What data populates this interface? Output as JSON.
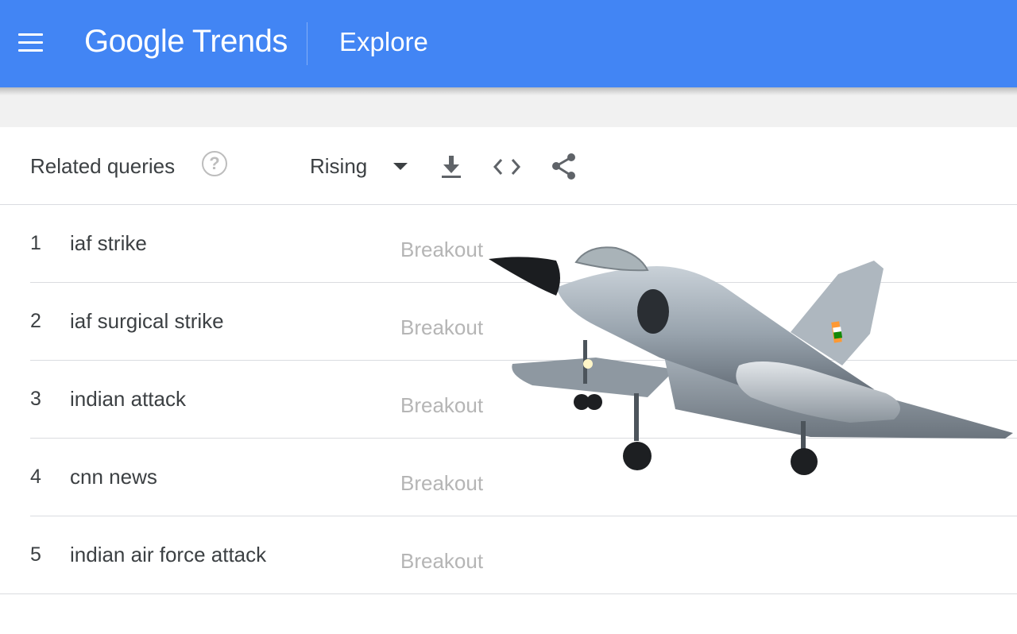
{
  "header": {
    "brand": "Google Trends",
    "title": "Explore",
    "menu_icon": "hamburger-menu-icon",
    "color": "#4285f4"
  },
  "card": {
    "title": "Related queries",
    "help_icon": "help-circle-icon",
    "filter_selected": "Rising",
    "tools": [
      "download-icon",
      "embed-code-icon",
      "share-icon"
    ]
  },
  "queries": [
    {
      "rank": "1",
      "query": "iaf strike",
      "value": "Breakout"
    },
    {
      "rank": "2",
      "query": "iaf surgical strike",
      "value": "Breakout"
    },
    {
      "rank": "3",
      "query": "indian attack",
      "value": "Breakout"
    },
    {
      "rank": "4",
      "query": "cnn news",
      "value": "Breakout"
    },
    {
      "rank": "5",
      "query": "indian air force attack",
      "value": "Breakout"
    }
  ],
  "overlay_image": "fighter-jet"
}
